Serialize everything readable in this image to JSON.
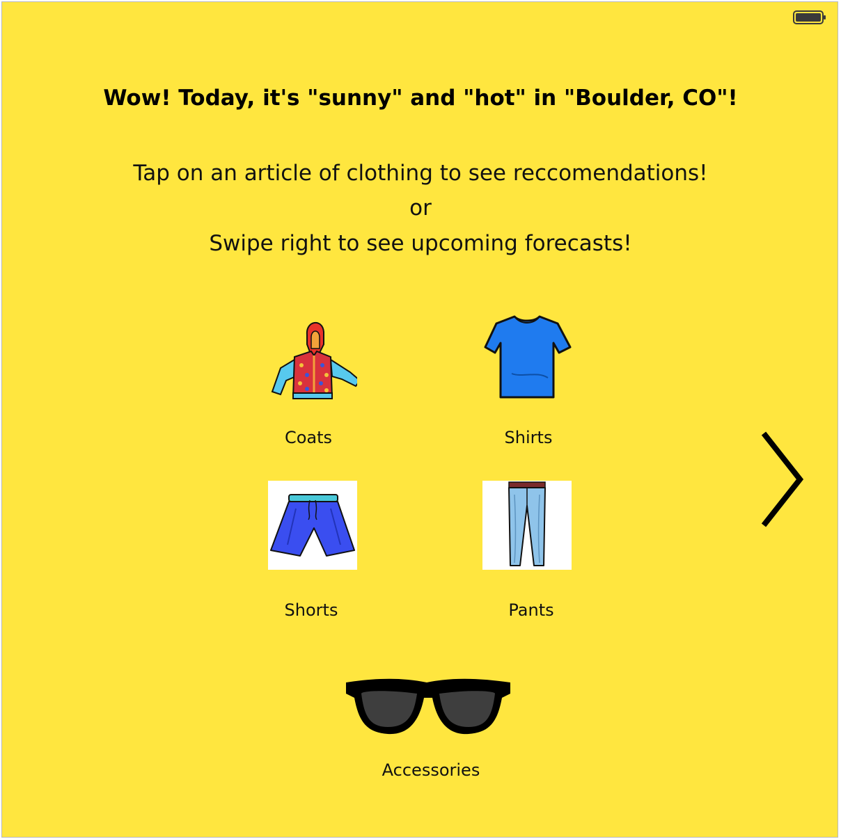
{
  "status_bar": {
    "battery_icon": "battery-full-icon"
  },
  "headline": "Wow! Today, it's \"sunny\" and \"hot\" in \"Boulder, CO\"!",
  "instructions": {
    "line1": "Tap on an article of clothing to see reccomendations!",
    "line2": "or",
    "line3": "Swipe right to see upcoming forecasts!"
  },
  "categories": [
    {
      "label": "Coats",
      "icon": "jacket-icon"
    },
    {
      "label": "Shirts",
      "icon": "tshirt-icon"
    },
    {
      "label": "Shorts",
      "icon": "shorts-icon"
    },
    {
      "label": "Pants",
      "icon": "jeans-icon"
    },
    {
      "label": "Accessories",
      "icon": "sunglasses-icon"
    }
  ],
  "navigation": {
    "next_icon": "chevron-right-icon"
  },
  "colors": {
    "background": "#ffe63f"
  }
}
